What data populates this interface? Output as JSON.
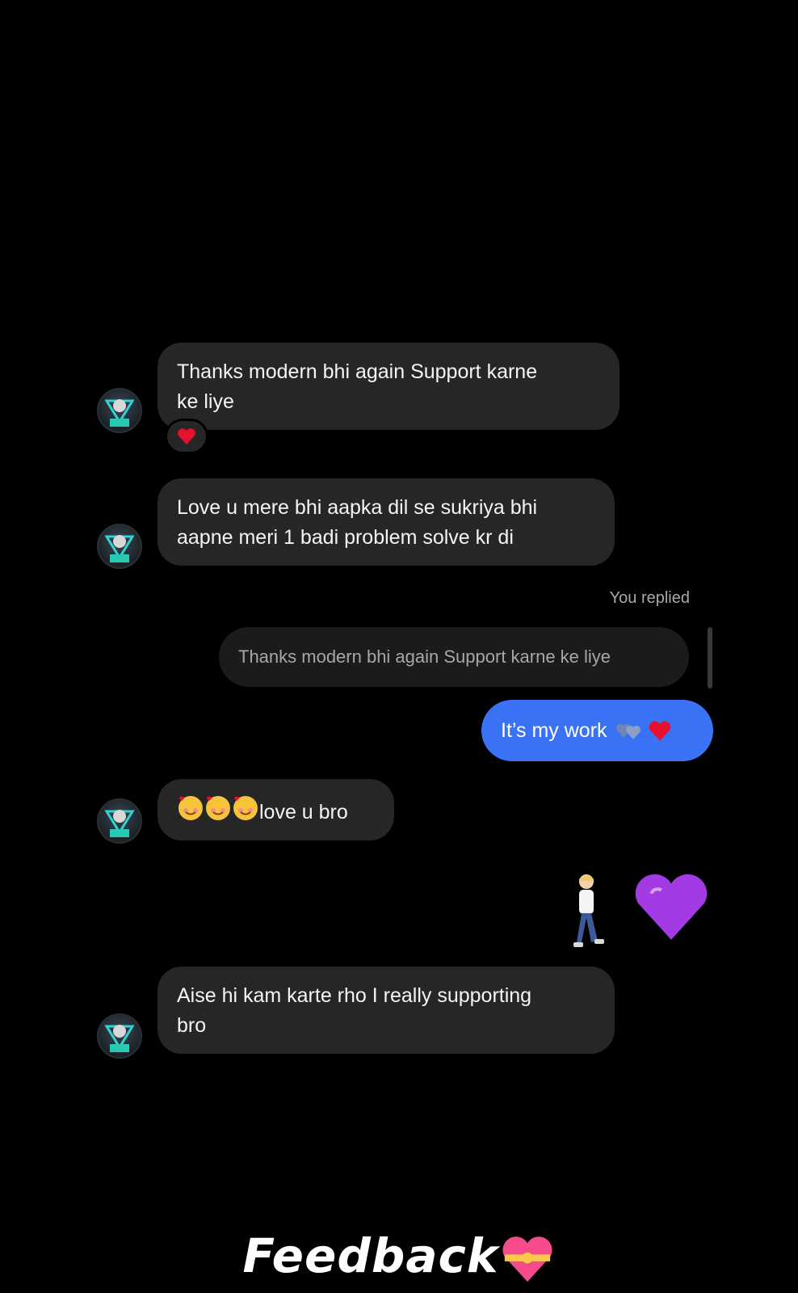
{
  "messages": [
    {
      "sender": "them",
      "text": "Thanks modern bhi again Support karne\nke liye",
      "reaction": "red-heart"
    },
    {
      "sender": "them",
      "text": "Love u mere bhi aapka dil se sukriya bhi\naapne meri 1 badi problem solve kr di"
    },
    {
      "sender": "me",
      "replied_label": "You replied",
      "quoted_text": "Thanks modern bhi again Support karne ke liye",
      "text": "It’s my work",
      "emojis": [
        "blue-hearts-emoji",
        "red-heart-emoji"
      ]
    },
    {
      "sender": "them",
      "text": "love u bro",
      "emoji_prefix": [
        "smiling-face-hearts-emoji",
        "smiling-face-hearts-emoji",
        "smiling-face-hearts-emoji"
      ]
    },
    {
      "sender": "me",
      "stickers": [
        "person-walking-emoji",
        "purple-heart-emoji"
      ]
    },
    {
      "sender": "them",
      "text": "Aise hi kam karte rho I really supporting\nbro"
    }
  ],
  "caption": {
    "text": "Feedback",
    "icon": "heart-with-ribbon-emoji"
  },
  "colors": {
    "background": "#000000",
    "incoming_bubble": "#262626",
    "outgoing_bubble": "#3a72f5",
    "quoted_bubble": "#1b1b1b"
  }
}
